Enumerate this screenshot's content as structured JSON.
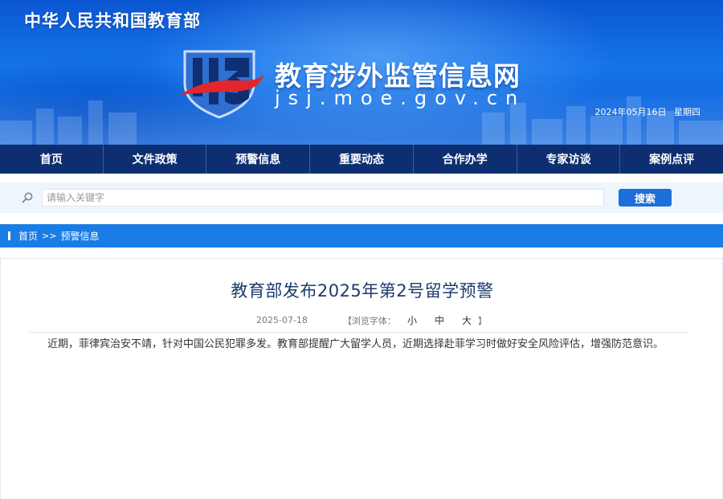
{
  "header": {
    "ministry_name": "中华人民共和国教育部",
    "site_title": "教育涉外监管信息网",
    "site_domain": "jsj.moe.gov.cn",
    "date": "2024年05月16日",
    "weekday": "星期四"
  },
  "nav": {
    "items": [
      {
        "label": "首页"
      },
      {
        "label": "文件政策"
      },
      {
        "label": "预警信息"
      },
      {
        "label": "重要动态"
      },
      {
        "label": "合作办学"
      },
      {
        "label": "专家访谈"
      },
      {
        "label": "案例点评"
      }
    ]
  },
  "search": {
    "placeholder": "请输入关键字",
    "value": "",
    "button_label": "搜索"
  },
  "breadcrumb": {
    "home": "首页",
    "separator": ">>",
    "current": "预警信息"
  },
  "article": {
    "title": "教育部发布2025年第2号留学预警",
    "date": "2025-07-18",
    "font_label": "【浏览字体：",
    "font_small": "小",
    "font_medium": "中",
    "font_large": "大",
    "font_close": "】",
    "body": "近期，菲律宾治安不靖，针对中国公民犯罪多发。教育部提醒广大留学人员，近期选择赴菲学习时做好安全风险评估，增强防范意识。"
  },
  "colors": {
    "banner_blue": "#1573ea",
    "nav_navy": "#0d2f72",
    "breadcrumb_blue": "#1a7de6",
    "search_button": "#1d6fd9",
    "emblem_red": "#e3262b",
    "title_navy": "#1e3b6e"
  },
  "icons": {
    "search": "search-icon",
    "emblem": "site-emblem-icon"
  }
}
